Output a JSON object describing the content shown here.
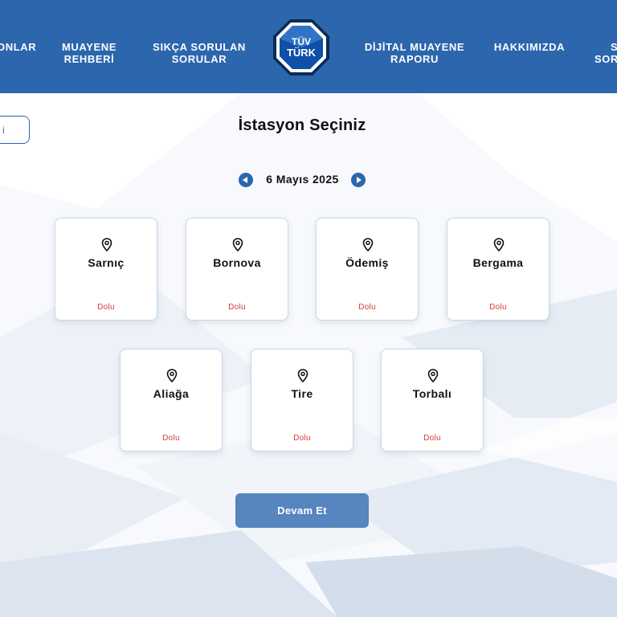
{
  "nav": {
    "items_left": [
      {
        "lines": [
          "ONLAR"
        ]
      },
      {
        "lines": [
          "MUAYENE",
          "REHBERİ"
        ]
      },
      {
        "lines": [
          "SIKÇA SORULAN",
          "SORULAR"
        ]
      }
    ],
    "items_right": [
      {
        "lines": [
          "DİJİTAL MUAYENE",
          "RAPORU"
        ]
      },
      {
        "lines": [
          "HAKKIMIZDA"
        ]
      },
      {
        "lines": [
          "S",
          "SOR"
        ]
      }
    ],
    "logo": {
      "line1": "TÜV",
      "line2": "TÜRK"
    }
  },
  "page": {
    "left_button_label": "i",
    "title": "İstasyon Seçiniz",
    "date": "6 Mayıs 2025",
    "continue_label": "Devam Et"
  },
  "stations": [
    {
      "name": "Sarnıç",
      "status": "Dolu"
    },
    {
      "name": "Bornova",
      "status": "Dolu"
    },
    {
      "name": "Ödemiş",
      "status": "Dolu"
    },
    {
      "name": "Bergama",
      "status": "Dolu"
    },
    {
      "name": "Aliağa",
      "status": "Dolu"
    },
    {
      "name": "Tire",
      "status": "Dolu"
    },
    {
      "name": "Torbalı",
      "status": "Dolu"
    }
  ],
  "colors": {
    "header": "#2c66ad",
    "status_full": "#d23b3b",
    "continue_button": "#5685bf"
  }
}
